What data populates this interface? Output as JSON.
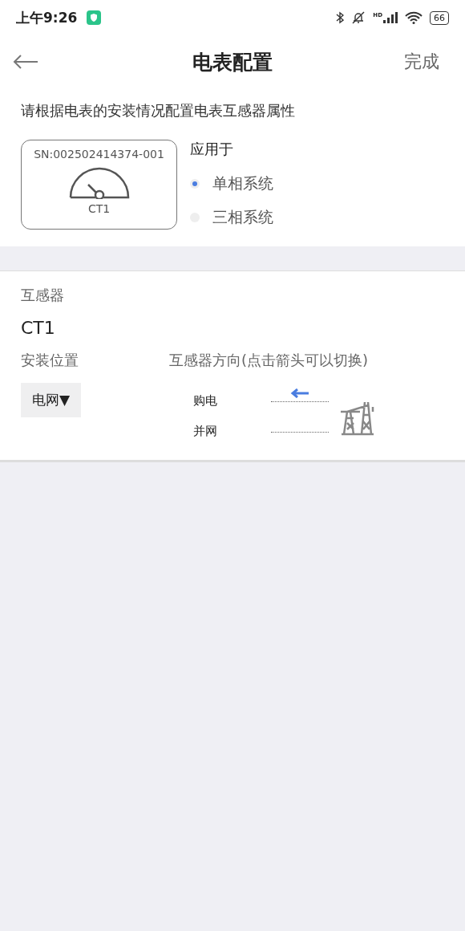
{
  "status_bar": {
    "time": "上午9:26",
    "network": "HD",
    "battery": "66"
  },
  "header": {
    "title": "电表配置",
    "action": "完成"
  },
  "description": "请根据电表的安装情况配置电表互感器属性",
  "meter_card": {
    "serial": "SN:002502414374-001",
    "label": "CT1"
  },
  "apply_to": {
    "label": "应用于",
    "options": [
      {
        "label": "单相系统",
        "selected": true
      },
      {
        "label": "三相系统",
        "selected": false
      }
    ]
  },
  "transformer": {
    "section_label": "互感器",
    "name": "CT1",
    "position_label": "安装位置",
    "position_value": "电网▼",
    "direction_label": "互感器方向(点击箭头可以切换)",
    "directions": [
      {
        "label": "购电",
        "arrow": true
      },
      {
        "label": "并网",
        "arrow": false
      }
    ]
  }
}
